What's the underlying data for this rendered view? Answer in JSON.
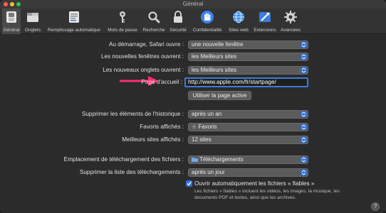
{
  "window": {
    "title": "Général"
  },
  "toolbar": {
    "items": [
      {
        "label": "Général",
        "icon": "general-switch-icon",
        "active": true
      },
      {
        "label": "Onglets",
        "icon": "tabs-icon"
      },
      {
        "label": "Remplissage automatique",
        "icon": "autofill-icon"
      },
      {
        "label": "Mots de passe",
        "icon": "key-icon"
      },
      {
        "label": "Recherche",
        "icon": "magnifier-icon"
      },
      {
        "label": "Sécurité",
        "icon": "padlock-icon"
      },
      {
        "label": "Confidentialité",
        "icon": "hand-icon"
      },
      {
        "label": "Sites web",
        "icon": "globe-icon"
      },
      {
        "label": "Extensions",
        "icon": "extensions-icon"
      },
      {
        "label": "Avancées",
        "icon": "gear-icon"
      }
    ]
  },
  "settings": {
    "startup_label": "Au démarrage, Safari ouvre :",
    "startup_value": "une nouvelle fenêtre",
    "new_windows_label": "Les nouvelles fenêtres ouvrent :",
    "new_windows_value": "les Meilleurs sites",
    "new_tabs_label": "Les nouveaux onglets ouvrent :",
    "new_tabs_value": "les Meilleurs sites",
    "homepage_label": "Page d'accueil :",
    "homepage_value": "http://www.apple.com/fr/startpage/",
    "use_current_page": "Utiliser la page active",
    "history_label": "Supprimer les éléments de l'historique :",
    "history_value": "après un an",
    "favorites_label": "Favoris affichés :",
    "favorites_value": "☆ Favoris",
    "top_sites_label": "Meilleurs sites affichés :",
    "top_sites_value": "12 sites",
    "download_location_label": "Emplacement de téléchargement des fichiers :",
    "download_location_value": "Téléchargements",
    "download_clear_label": "Supprimer la liste des téléchargements :",
    "download_clear_value": "après un jour",
    "open_safe_label": "Ouvrir automatiquement les fichiers « fiables »",
    "open_safe_checked": true,
    "open_safe_note": "Les fichiers « fiables » incluent les vidéos, les images, la musique, les documents PDF et textes, ainsi que les archives."
  },
  "help": {
    "label": "?"
  },
  "colors": {
    "accent": "#2f6fdc",
    "arrow": "#ff2d6f"
  }
}
